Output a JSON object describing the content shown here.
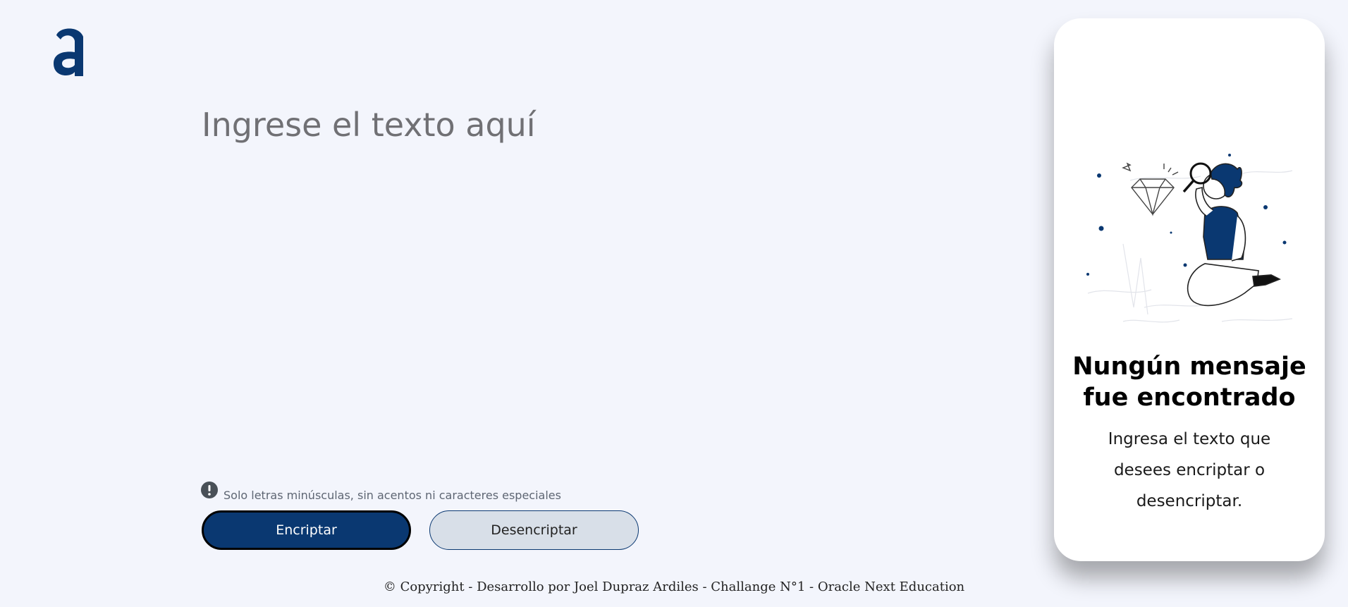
{
  "logo": {
    "icon": "alura-a-logo-icon",
    "color": "#0a3871"
  },
  "input": {
    "placeholder": "Ingrese el texto aquí",
    "value": ""
  },
  "hint": {
    "icon": "exclamation-circle-icon",
    "text": "Solo letras minúsculas, sin acentos ni caracteres especiales"
  },
  "buttons": {
    "encrypt_label": "Encriptar",
    "decrypt_label": "Desencriptar"
  },
  "output_panel": {
    "illustration": "person-with-magnifying-glass-illustration",
    "title": "Nungún mensaje fue encontrado",
    "subtitle": "Ingresa el texto que desees encriptar o desencriptar."
  },
  "footer": {
    "text": "© Copyright - Desarrollo por Joel Dupraz Ardiles - Challange N°1 - Oracle Next Education"
  },
  "colors": {
    "background": "#f3f5fc",
    "primary": "#0a3871",
    "secondary_button": "#d8dfe8",
    "placeholder": "#707074"
  }
}
